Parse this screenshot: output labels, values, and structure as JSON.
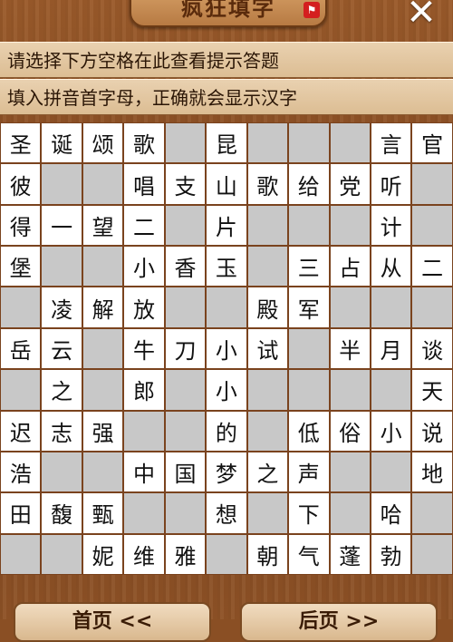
{
  "header": {
    "title": "疯狂填字",
    "badge_icon": "flag-icon",
    "close_label": "✕"
  },
  "hints": {
    "line1": "请选择下方空格在此查看提示答题",
    "line2": "填入拼音首字母，正确就会显示汉字"
  },
  "grid": [
    [
      "圣",
      "诞",
      "颂",
      "歌",
      "",
      "昆",
      "",
      "",
      "",
      "言",
      "官"
    ],
    [
      "彼",
      "",
      "",
      "唱",
      "支",
      "山",
      "歌",
      "给",
      "党",
      "听",
      ""
    ],
    [
      "得",
      "一",
      "望",
      "二",
      "",
      "片",
      "",
      "",
      "",
      "计",
      ""
    ],
    [
      "堡",
      "",
      "",
      "小",
      "香",
      "玉",
      "",
      "三",
      "占",
      "从",
      "二"
    ],
    [
      "",
      "凌",
      "解",
      "放",
      "",
      "",
      "殿",
      "军",
      "",
      "",
      ""
    ],
    [
      "岳",
      "云",
      "",
      "牛",
      "刀",
      "小",
      "试",
      "",
      "半",
      "月",
      "谈"
    ],
    [
      "",
      "之",
      "",
      "郎",
      "",
      "小",
      "",
      "",
      "",
      "",
      "天"
    ],
    [
      "迟",
      "志",
      "强",
      "",
      "",
      "的",
      "",
      "低",
      "俗",
      "小",
      "说"
    ],
    [
      "浩",
      "",
      "",
      "中",
      "国",
      "梦",
      "之",
      "声",
      "",
      "",
      "地"
    ],
    [
      "田",
      "馥",
      "甄",
      "",
      "",
      "想",
      "",
      "下",
      "",
      "哈",
      ""
    ],
    [
      "",
      "",
      "妮",
      "维",
      "雅",
      "",
      "朝",
      "气",
      "蓬",
      "勃",
      ""
    ]
  ],
  "grid_white": [
    [
      1,
      1,
      1,
      1,
      0,
      1,
      0,
      0,
      0,
      1,
      1
    ],
    [
      1,
      0,
      0,
      1,
      1,
      1,
      1,
      1,
      1,
      1,
      0
    ],
    [
      1,
      1,
      1,
      1,
      0,
      1,
      0,
      0,
      0,
      1,
      0
    ],
    [
      1,
      0,
      0,
      1,
      1,
      1,
      0,
      1,
      1,
      1,
      1
    ],
    [
      0,
      1,
      1,
      1,
      0,
      0,
      1,
      1,
      0,
      0,
      0
    ],
    [
      1,
      1,
      0,
      1,
      1,
      1,
      1,
      0,
      1,
      1,
      1
    ],
    [
      0,
      1,
      0,
      1,
      0,
      1,
      0,
      0,
      0,
      0,
      1
    ],
    [
      1,
      1,
      1,
      0,
      0,
      1,
      0,
      1,
      1,
      1,
      1
    ],
    [
      1,
      0,
      0,
      1,
      1,
      1,
      1,
      1,
      0,
      0,
      1
    ],
    [
      1,
      1,
      1,
      0,
      0,
      1,
      0,
      1,
      0,
      1,
      0
    ],
    [
      0,
      0,
      1,
      1,
      1,
      0,
      1,
      1,
      1,
      1,
      0
    ]
  ],
  "footer": {
    "prev_label": "首页  <<",
    "next_label": "后页  >>"
  }
}
